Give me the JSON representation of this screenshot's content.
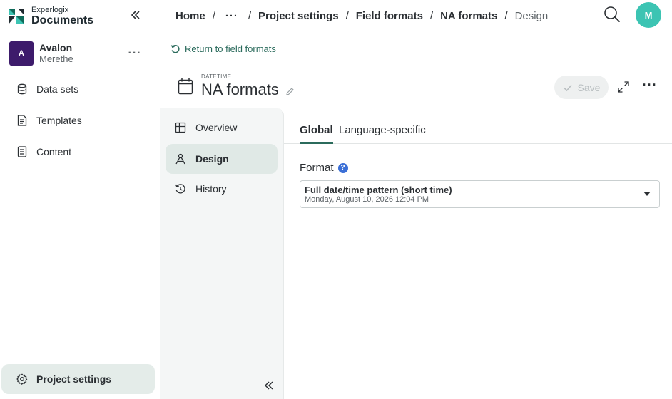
{
  "brand": {
    "top": "Experlogix",
    "bottom": "Documents"
  },
  "account": {
    "initial": "A",
    "name": "Avalon",
    "sub": "Merethe",
    "more": "···"
  },
  "sidebar": {
    "items": [
      {
        "label": "Data sets",
        "icon": "database-icon"
      },
      {
        "label": "Templates",
        "icon": "document-icon"
      },
      {
        "label": "Content",
        "icon": "content-icon"
      }
    ],
    "footer": {
      "label": "Project settings",
      "icon": "gear-icon"
    }
  },
  "breadcrumb": {
    "home": "Home",
    "more": "···",
    "items": [
      "Project settings",
      "Field formats",
      "NA formats"
    ],
    "current": "Design",
    "sep": "/"
  },
  "user": {
    "initial": "M"
  },
  "return_link": "Return to field formats",
  "page": {
    "kind": "DATETIME",
    "title": "NA formats"
  },
  "toolbar": {
    "save_label": "Save",
    "more": "···"
  },
  "inner_nav": {
    "items": [
      {
        "label": "Overview",
        "icon": "grid-icon",
        "active": false
      },
      {
        "label": "Design",
        "icon": "design-icon",
        "active": true
      },
      {
        "label": "History",
        "icon": "history-icon",
        "active": false
      }
    ]
  },
  "tabs": [
    "Global",
    "Language-specific"
  ],
  "format": {
    "label": "Format",
    "help": "?",
    "value": "Full date/time pattern (short time)",
    "example": "Monday, August 10, 2026 12:04 PM"
  },
  "colors": {
    "accent": "#2b6b5c",
    "account_avatar": "#3d1b6b",
    "user_avatar": "#3cc4b3",
    "help": "#3b6fd6",
    "active_bg": "#e0e9e6"
  }
}
